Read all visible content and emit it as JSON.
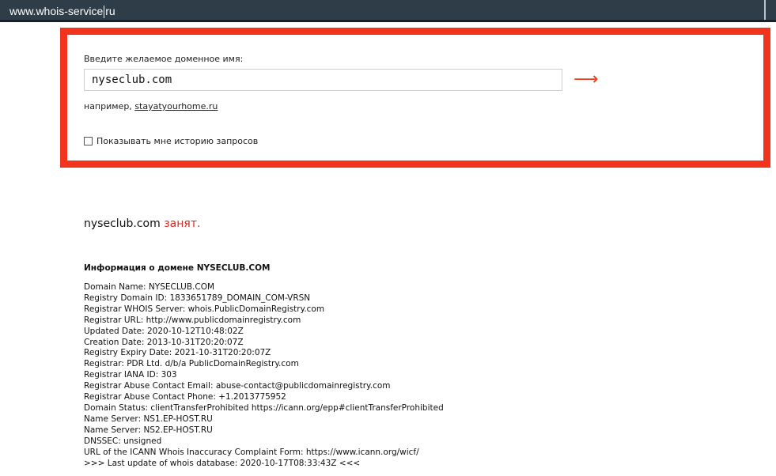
{
  "address_bar": {
    "url_part1": "www.whois-service",
    "url_part2": "ru"
  },
  "form": {
    "label": "Введите желаемое доменное имя:",
    "input_value": "nyseclub.com",
    "submit_icon": "right-arrow-icon",
    "example_prefix": "например,",
    "example_link": "stayatyourhome.ru",
    "history_label": "Показывать мне историю запросов",
    "history_checked": false
  },
  "result": {
    "domain": "nyseclub.com",
    "status": "занят."
  },
  "info": {
    "heading": "Информация о домене NYSECLUB.COM",
    "lines": [
      "Domain Name: NYSECLUB.COM",
      "Registry Domain ID: 1833651789_DOMAIN_COM-VRSN",
      "Registrar WHOIS Server: whois.PublicDomainRegistry.com",
      "Registrar URL: http://www.publicdomainregistry.com",
      "Updated Date: 2020-10-12T10:48:02Z",
      "Creation Date: 2013-10-31T20:20:07Z",
      "Registry Expiry Date: 2021-10-31T20:20:07Z",
      "Registrar: PDR Ltd. d/b/a PublicDomainRegistry.com",
      "Registrar IANA ID: 303",
      "Registrar Abuse Contact Email: abuse-contact@publicdomainregistry.com",
      "Registrar Abuse Contact Phone: +1.2013775952",
      "Domain Status: clientTransferProhibited https://icann.org/epp#clientTransferProhibited",
      "Name Server: NS1.EP-HOST.RU",
      "Name Server: NS2.EP-HOST.RU",
      "DNSSEC: unsigned",
      "URL of the ICANN Whois Inaccuracy Complaint Form: https://www.icann.org/wicf/",
      ">>> Last update of whois database: 2020-10-17T08:33:43Z <<<"
    ]
  },
  "colors": {
    "highlight_border": "#f0341e",
    "status_red": "#d52b1e",
    "address_bar_bg": "#2f3d49"
  }
}
